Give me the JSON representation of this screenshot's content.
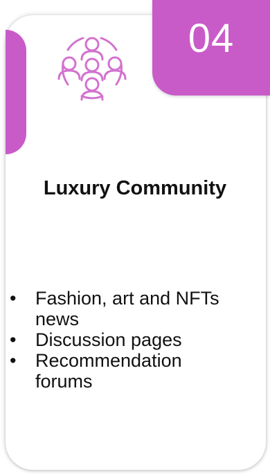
{
  "card": {
    "number": "04",
    "title": "Luxury Community",
    "icon": "community-people-icon",
    "bullets": [
      "Fashion, art and NFTs news",
      "Discussion pages",
      "Recommendation forums"
    ]
  },
  "colors": {
    "accent": "#c95bc8",
    "icon_stroke": "#d272cf",
    "text": "#111111"
  }
}
